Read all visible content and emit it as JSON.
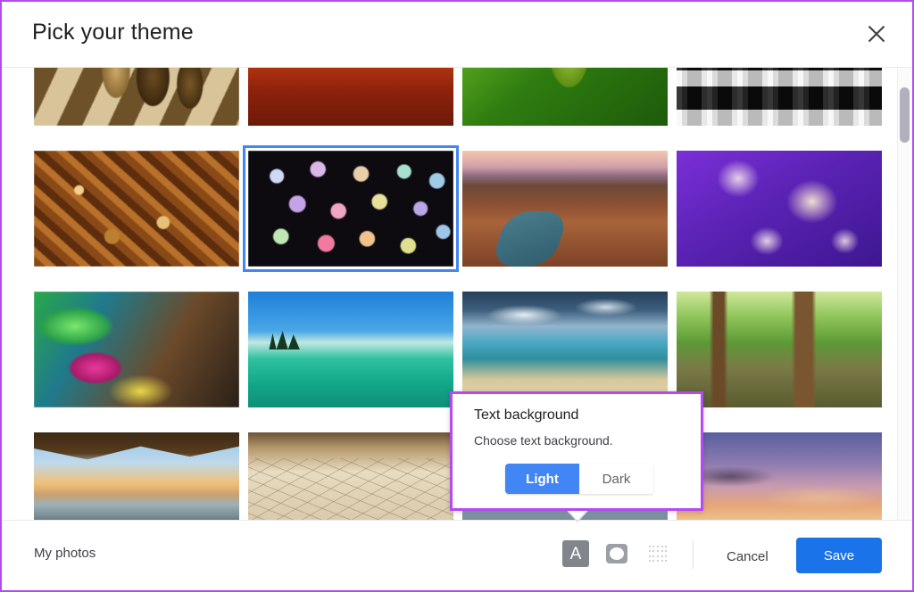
{
  "dialog": {
    "title": "Pick your theme",
    "close_icon": "close-icon",
    "accent_color": "#1a73e8",
    "selection_color": "#4285f4",
    "highlight_color": "#b44af0"
  },
  "themes": [
    {
      "name": "Chess pieces",
      "art": "art-chess",
      "selected": false
    },
    {
      "name": "Canyon dunes",
      "art": "art-canyon",
      "selected": false
    },
    {
      "name": "Green bud",
      "art": "art-bud",
      "selected": false
    },
    {
      "name": "Metal pipes",
      "art": "art-pipes",
      "selected": false
    },
    {
      "name": "Autumn leaves",
      "art": "art-leaves",
      "selected": false
    },
    {
      "name": "Colored chalk bokeh",
      "art": "art-chalk",
      "selected": true
    },
    {
      "name": "Canyon river",
      "art": "art-canyonriver",
      "selected": false
    },
    {
      "name": "Purple jellyfish",
      "art": "art-jelly",
      "selected": false
    },
    {
      "name": "Color water droplet",
      "art": "art-droplet",
      "selected": false
    },
    {
      "name": "Lake and pines",
      "art": "art-lake",
      "selected": false
    },
    {
      "name": "Stormy beach",
      "art": "art-beach",
      "selected": false
    },
    {
      "name": "Green forest stream",
      "art": "art-forest",
      "selected": false
    },
    {
      "name": "Golden Gate bridge",
      "art": "art-bridge",
      "selected": false
    },
    {
      "name": "Cracked salt flat",
      "art": "art-saltflat",
      "selected": false
    },
    {
      "name": "Mountain haze",
      "art": "art-mountains",
      "selected": false
    },
    {
      "name": "Sunset clouds",
      "art": "art-sunsetsky",
      "selected": false
    }
  ],
  "popup": {
    "title": "Text background",
    "description": "Choose text background.",
    "options": [
      {
        "label": "Light",
        "selected": true
      },
      {
        "label": "Dark",
        "selected": false
      }
    ]
  },
  "footer": {
    "my_photos_label": "My photos",
    "tools": [
      {
        "name": "text-style-icon",
        "label": "A",
        "active": true
      },
      {
        "name": "vignette-icon",
        "label": "",
        "active": false
      },
      {
        "name": "pattern-icon",
        "label": "",
        "active": false
      }
    ],
    "cancel_label": "Cancel",
    "save_label": "Save"
  }
}
